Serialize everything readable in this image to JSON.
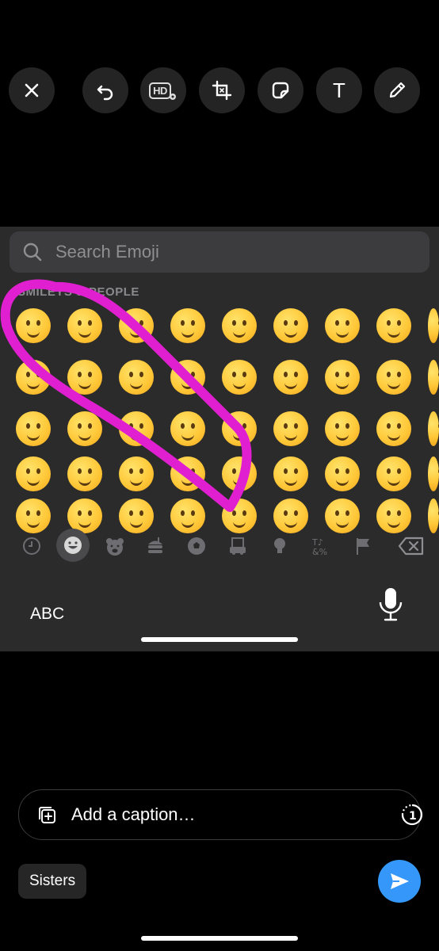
{
  "toolbar": {
    "close_icon": "close-icon",
    "undo_icon": "undo-icon",
    "hd_label": "HD",
    "crop_icon": "crop-icon",
    "sticker_icon": "sticker-icon",
    "text_label": "T",
    "draw_icon": "pencil-icon"
  },
  "emoji_keyboard": {
    "search_placeholder": "Search Emoji",
    "section_title": "SMILEYS & PEOPLE",
    "categories": [
      "recent",
      "smileys",
      "animals",
      "food",
      "activity",
      "travel",
      "objects",
      "symbols",
      "flags"
    ],
    "active_category": "smileys",
    "abc_label": "ABC",
    "annotation_color": "#e020d0"
  },
  "caption": {
    "placeholder": "Add a caption…"
  },
  "recipient": {
    "label": "Sisters"
  },
  "colors": {
    "send_button": "#3497f9",
    "keyboard_bg": "#2b2b2b"
  }
}
